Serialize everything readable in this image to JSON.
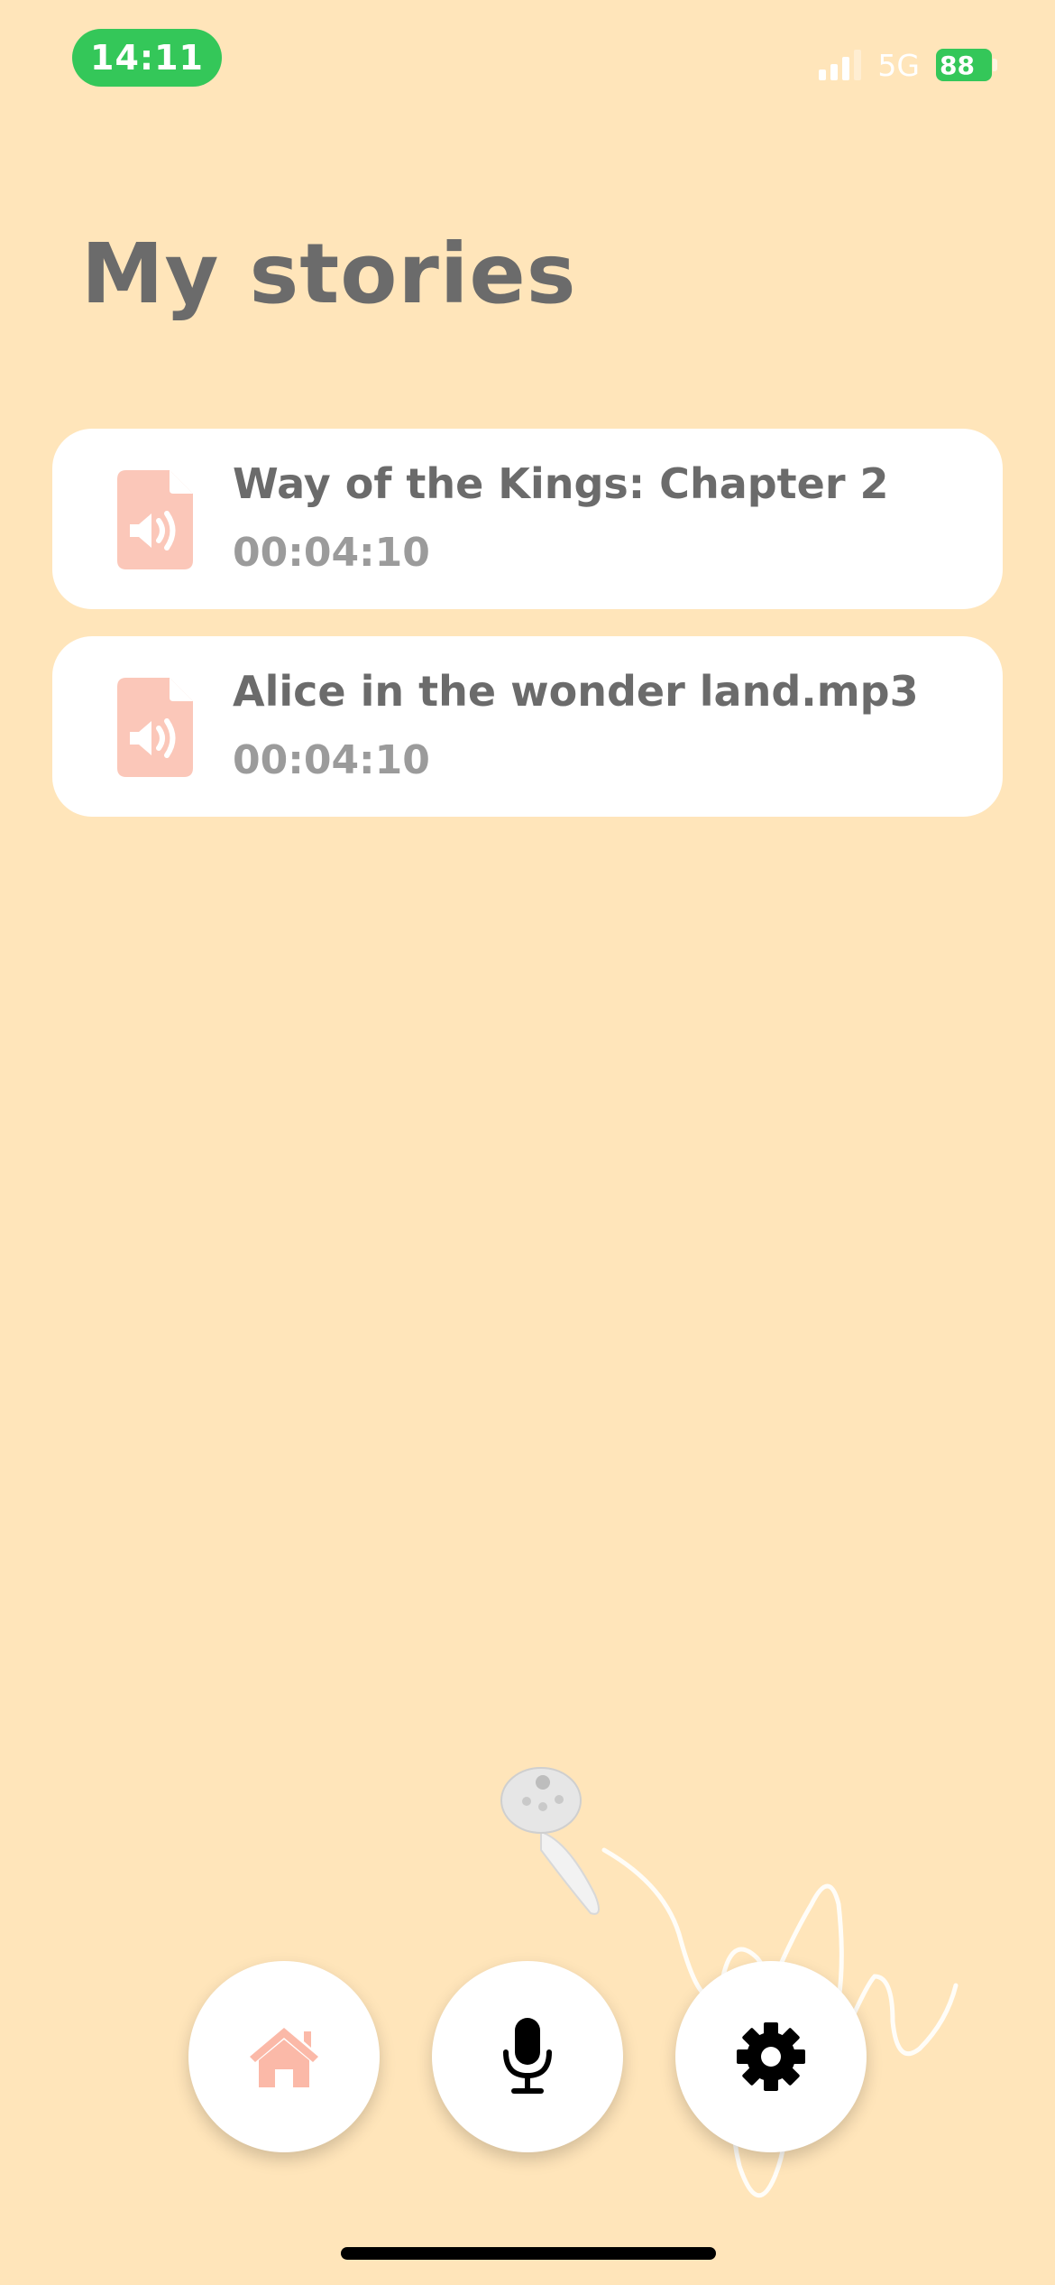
{
  "status_bar": {
    "time": "14:11",
    "network": "5G",
    "battery": "88"
  },
  "page": {
    "title": "My stories"
  },
  "stories": [
    {
      "title": "Way of the Kings: Chapter 2",
      "duration": "00:04:10",
      "icon": "audio-file-icon"
    },
    {
      "title": "Alice in the wonder land.mp3",
      "duration": "00:04:10",
      "icon": "audio-file-icon"
    }
  ],
  "nav": [
    {
      "name": "home",
      "icon": "home-icon",
      "color": "#FBB9A8",
      "active": true
    },
    {
      "name": "record",
      "icon": "microphone-icon",
      "color": "#000000"
    },
    {
      "name": "settings",
      "icon": "gear-icon",
      "color": "#000000"
    }
  ],
  "colors": {
    "background": "#FFE5BA",
    "accent": "#FBC7B9",
    "status_green": "#34C759"
  }
}
